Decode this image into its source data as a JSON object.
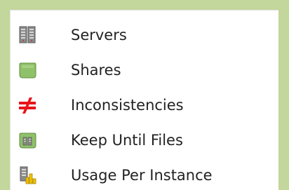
{
  "tree": {
    "items": [
      {
        "label": "Servers",
        "icon": "servers-icon"
      },
      {
        "label": "Shares",
        "icon": "share-folder-icon"
      },
      {
        "label": "Inconsistencies",
        "icon": "not-equal-icon",
        "icon_color": "#e8151b"
      },
      {
        "label": "Keep Until Files",
        "icon": "keep-files-icon"
      },
      {
        "label": "Usage Per Instance",
        "icon": "usage-chart-icon"
      }
    ]
  },
  "colors": {
    "frame_background": "#c3d69b",
    "panel_background": "#ffffff"
  }
}
